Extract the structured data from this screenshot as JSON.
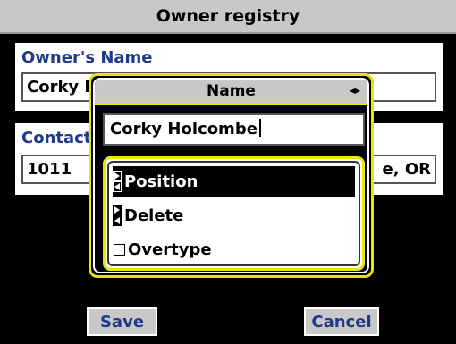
{
  "window": {
    "title": "Owner registry"
  },
  "owner_section": {
    "label": "Owner's Name",
    "value": "Corky Holcombe"
  },
  "contact_section": {
    "label": "Contact",
    "value_left": "1011",
    "value_right": "e, OR"
  },
  "buttons": {
    "save": "Save",
    "cancel": "Cancel"
  },
  "dialog": {
    "title": "Name",
    "input_value": "Corky Holcombe",
    "menu": [
      {
        "label": "Position",
        "icon": "left-right-selector-icon",
        "selected": true
      },
      {
        "label": "Delete",
        "icon": "left-right-selector-icon",
        "selected": false
      },
      {
        "label": "Overtype",
        "icon": "checkbox-icon",
        "checked": false
      }
    ]
  },
  "colors": {
    "label_blue": "#1f3b87",
    "highlight_yellow": "#e6e600",
    "titlebar_gray": "#c8c8c8"
  }
}
